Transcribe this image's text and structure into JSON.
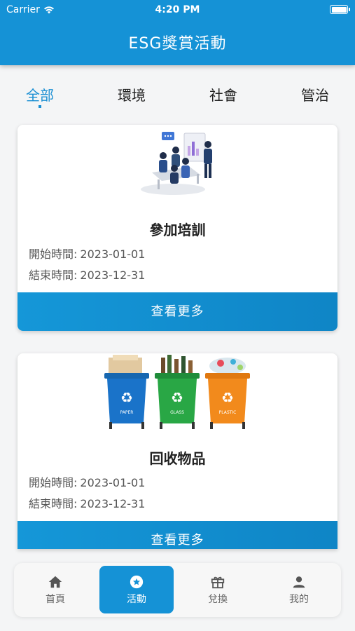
{
  "status_bar": {
    "carrier": "Carrier",
    "time": "4:20 PM"
  },
  "header": {
    "title": "ESG獎賞活動"
  },
  "tabs": [
    {
      "label": "全部",
      "active": true
    },
    {
      "label": "環境",
      "active": false
    },
    {
      "label": "社會",
      "active": false
    },
    {
      "label": "管治",
      "active": false
    }
  ],
  "cards": [
    {
      "title": "參加培訓",
      "start_label": "開始時間:",
      "start_date": "2023-01-01",
      "end_label": "結束時間:",
      "end_date": "2023-12-31",
      "button_label": "查看更多",
      "image": "meeting-training-illustration"
    },
    {
      "title": "回收物品",
      "start_label": "開始時間:",
      "start_date": "2023-01-01",
      "end_label": "結束時間:",
      "end_date": "2023-12-31",
      "button_label": "查看更多",
      "image": "recycling-bins-illustration",
      "bin_labels": [
        "PAPER",
        "GLASS",
        "PLASTIC"
      ]
    }
  ],
  "bottom_nav": [
    {
      "label": "首頁",
      "icon": "home-icon",
      "active": false
    },
    {
      "label": "活動",
      "icon": "star-circle-icon",
      "active": true
    },
    {
      "label": "兌換",
      "icon": "gift-icon",
      "active": false
    },
    {
      "label": "我的",
      "icon": "person-icon",
      "active": false
    }
  ],
  "colors": {
    "primary": "#1592d6",
    "background": "#f4f5f6",
    "bin_blue": "#1a73c9",
    "bin_green": "#29a745",
    "bin_orange": "#f28a1c"
  }
}
